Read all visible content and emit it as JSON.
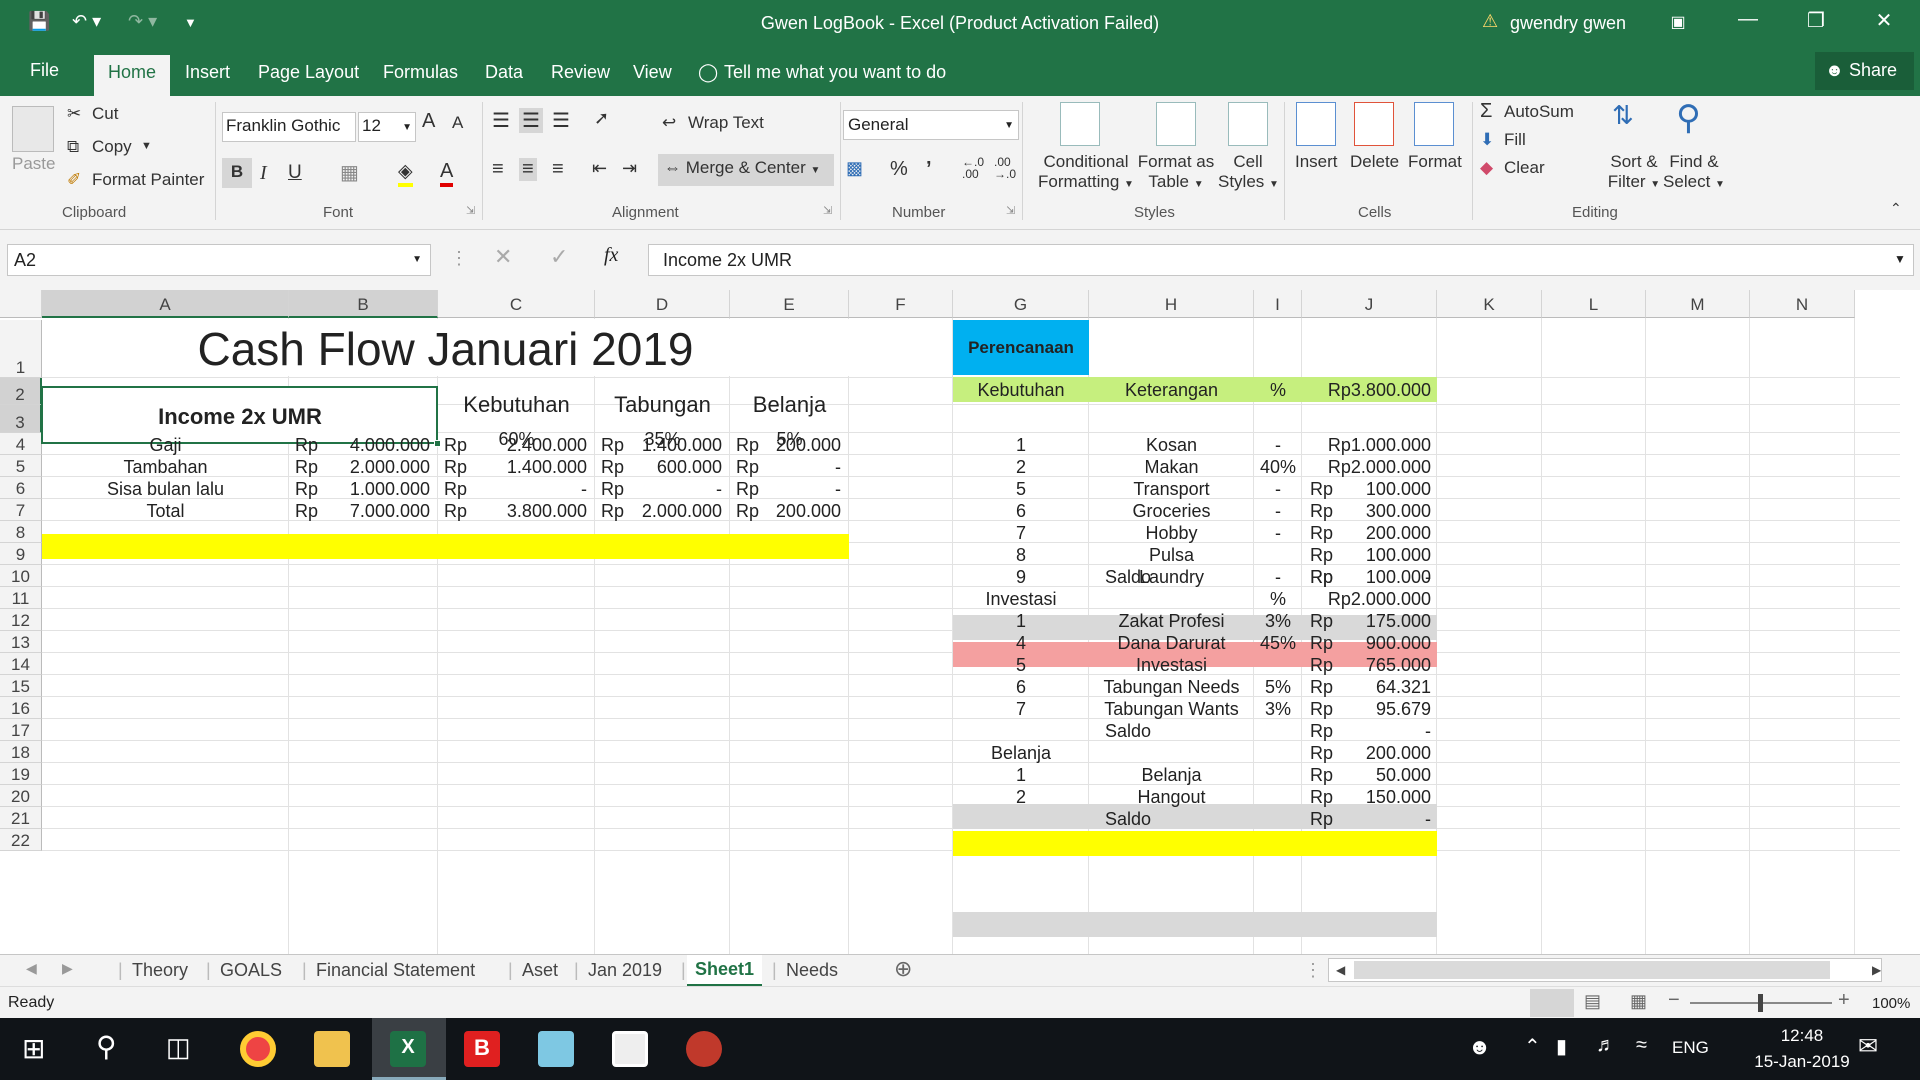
{
  "window": {
    "title": "Gwen LogBook - Excel (Product Activation Failed)",
    "user": "gwendry gwen"
  },
  "tabs": {
    "file": "File",
    "home": "Home",
    "insert": "Insert",
    "page_layout": "Page Layout",
    "formulas": "Formulas",
    "data": "Data",
    "review": "Review",
    "view": "View",
    "tell_me": "Tell me what you want to do",
    "share": "Share"
  },
  "ribbon": {
    "paste": "Paste",
    "cut": "Cut",
    "copy": "Copy",
    "format_painter": "Format Painter",
    "clipboard": "Clipboard",
    "font_name": "Franklin Gothic",
    "font_size": "12",
    "font": "Font",
    "wrap_text": "Wrap Text",
    "merge_center": "Merge & Center",
    "alignment": "Alignment",
    "number_format": "General",
    "number": "Number",
    "cond_format_1": "Conditional",
    "cond_format_2": "Formatting",
    "format_table_1": "Format as",
    "format_table_2": "Table",
    "cell_styles_1": "Cell",
    "cell_styles_2": "Styles",
    "styles": "Styles",
    "insert": "Insert",
    "delete": "Delete",
    "format": "Format",
    "cells": "Cells",
    "autosum": "AutoSum",
    "fill": "Fill",
    "clear": "Clear",
    "sort_1": "Sort &",
    "sort_2": "Filter",
    "find_1": "Find &",
    "find_2": "Select",
    "editing": "Editing"
  },
  "formula_bar": {
    "name_box": "A2",
    "formula": "Income 2x UMR"
  },
  "columns": [
    "A",
    "B",
    "C",
    "D",
    "E",
    "F",
    "G",
    "H",
    "I",
    "J",
    "K",
    "L",
    "M",
    "N"
  ],
  "rows": [
    "1",
    "2",
    "3",
    "4",
    "5",
    "6",
    "7",
    "8",
    "9",
    "10",
    "11",
    "12",
    "13",
    "14",
    "15",
    "16",
    "17",
    "18",
    "19",
    "20",
    "21",
    "22"
  ],
  "sheet": {
    "title": "Cash Flow Januari 2019",
    "income_header": "Income 2x UMR",
    "kebutuhan": "Kebutuhan",
    "tabungan": "Tabungan",
    "belanja": "Belanja",
    "pct_kebutuhan": "60%",
    "pct_tabungan": "35%",
    "pct_belanja": "5%",
    "rows": [
      {
        "label": "Gaji",
        "b": "4.000.000",
        "c": "2.400.000",
        "d": "1.400.000",
        "e": "200.000"
      },
      {
        "label": "Tambahan",
        "b": "2.000.000",
        "c": "1.400.000",
        "d": "600.000",
        "e": "-"
      },
      {
        "label": "Sisa bulan lalu",
        "b": "1.000.000",
        "c": "-",
        "d": "-",
        "e": "-"
      },
      {
        "label": "Total",
        "b": "7.000.000",
        "c": "3.800.000",
        "d": "2.000.000",
        "e": "200.000"
      }
    ],
    "rp": "Rp",
    "perencanaan": "Perencanaan",
    "plan_header": {
      "g": "Kebutuhan",
      "h": "Keterangan",
      "i": "%",
      "j": "Rp3.800.000"
    },
    "plan_kebutuhan": [
      {
        "n": "1",
        "k": "Kosan",
        "p": "-",
        "v": "Rp1.000.000"
      },
      {
        "n": "2",
        "k": "Makan",
        "p": "40%",
        "v": "Rp2.000.000"
      },
      {
        "n": "5",
        "k": "Transport",
        "p": "-",
        "v": "100.000"
      },
      {
        "n": "6",
        "k": "Groceries",
        "p": "-",
        "v": "300.000"
      },
      {
        "n": "7",
        "k": "Hobby",
        "p": "-",
        "v": "200.000"
      },
      {
        "n": "8",
        "k": "Pulsa",
        "p": "",
        "v": "100.000"
      },
      {
        "n": "9",
        "k": "Laundry",
        "p": "-",
        "v": "100.000"
      }
    ],
    "saldo": "Saldo",
    "dash": "-",
    "investasi_header": {
      "g": "Investasi",
      "i": "%",
      "j": "Rp2.000.000"
    },
    "plan_investasi": [
      {
        "n": "1",
        "k": "Zakat Profesi",
        "p": "3%",
        "v": "175.000"
      },
      {
        "n": "4",
        "k": "Dana Darurat",
        "p": "45%",
        "v": "900.000"
      },
      {
        "n": "5",
        "k": "Investasi",
        "p": "",
        "v": "765.000"
      },
      {
        "n": "6",
        "k": "Tabungan Needs",
        "p": "5%",
        "v": "64.321"
      },
      {
        "n": "7",
        "k": "Tabungan Wants",
        "p": "3%",
        "v": "95.679"
      }
    ],
    "belanja_header": {
      "g": "Belanja",
      "j": "200.000"
    },
    "plan_belanja": [
      {
        "n": "1",
        "k": "Belanja",
        "v": "50.000"
      },
      {
        "n": "2",
        "k": "Hangout",
        "v": "150.000"
      }
    ]
  },
  "sheet_tabs": [
    "Theory",
    "GOALS",
    "Financial Statement",
    "Aset",
    "Jan 2019",
    "Sheet1",
    "Needs"
  ],
  "active_sheet": "Sheet1",
  "status": {
    "ready": "Ready",
    "zoom": "100%"
  },
  "taskbar": {
    "lang": "ENG",
    "time": "12:48",
    "date": "15-Jan-2019"
  },
  "colors": {
    "excel_green": "#217346",
    "yellow": "#ffff00",
    "light_green": "#c6ef7e",
    "pink": "#f4a0a0",
    "grey": "#d9d9d9",
    "cyan": "#00b0f0"
  }
}
